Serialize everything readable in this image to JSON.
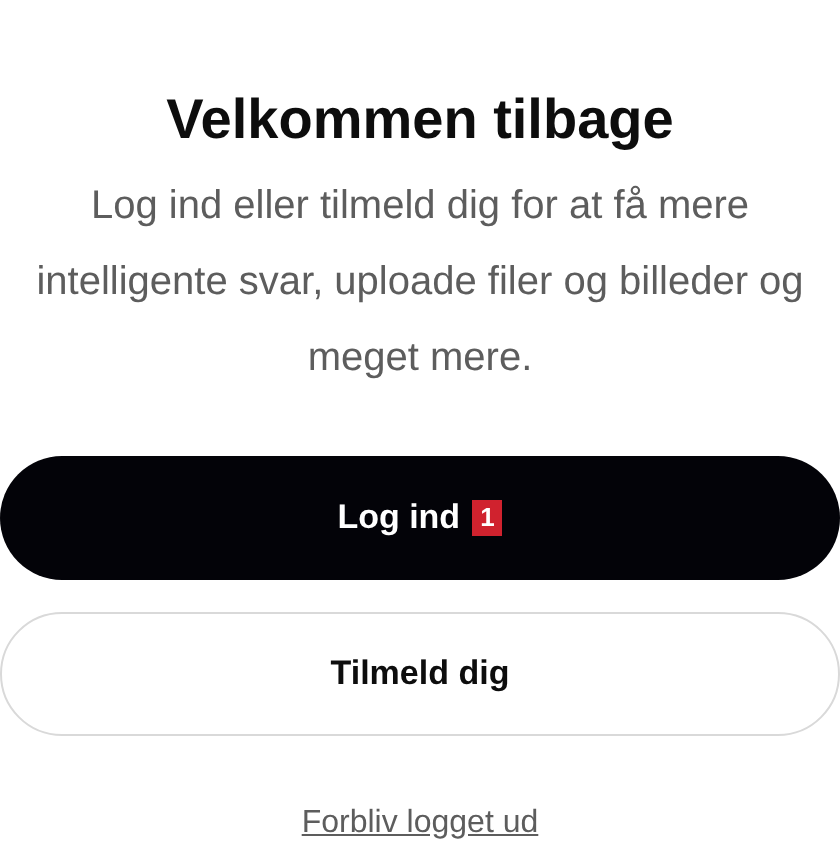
{
  "heading": "Velkommen tilbage",
  "description": "Log ind eller tilmeld dig for at få mere intelligente svar, uploade filer og billeder og meget mere.",
  "buttons": [
    {
      "label": "Log ind",
      "kind": "primary",
      "badge": "1"
    },
    {
      "label": "Tilmeld dig",
      "kind": "secondary"
    }
  ],
  "link": "Forbliv logget ud"
}
